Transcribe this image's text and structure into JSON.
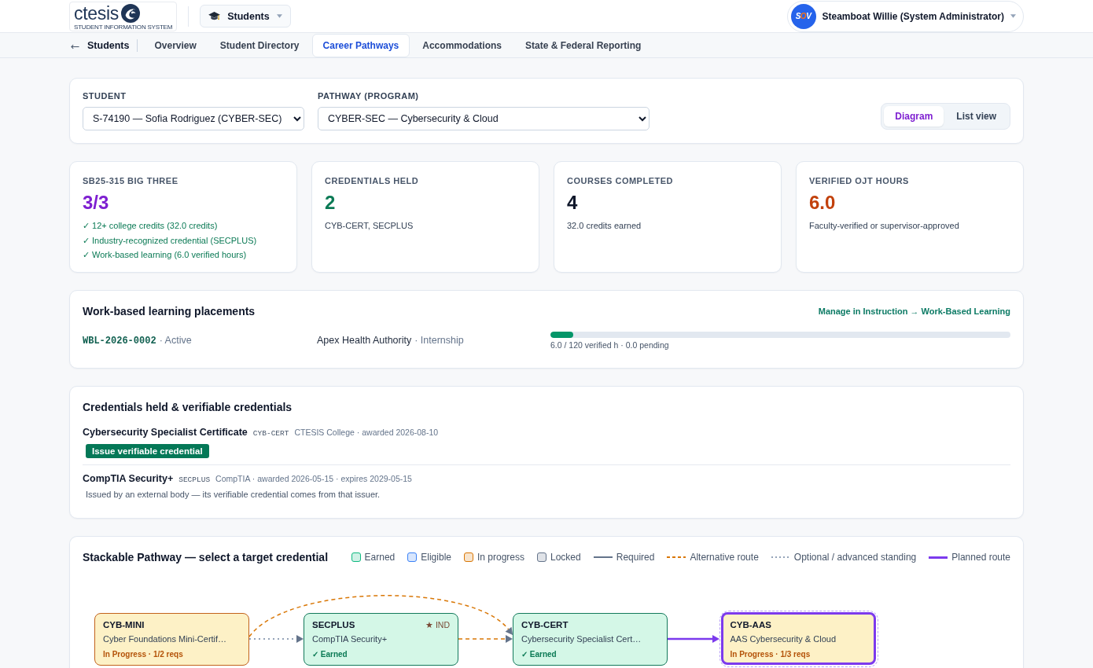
{
  "header": {
    "logo": {
      "wordmark": "ctesis",
      "tagline": "STUDENT INFORMATION SYSTEM"
    },
    "module": {
      "label": "Students"
    },
    "user": {
      "avatar": "SOV",
      "name": "Steamboat Willie (System Administrator)"
    }
  },
  "subnav": {
    "section": "Students",
    "tabs": [
      {
        "label": "Overview",
        "selected": false
      },
      {
        "label": "Student Directory",
        "selected": false
      },
      {
        "label": "Career Pathways",
        "selected": true
      },
      {
        "label": "Accommodations",
        "selected": false
      },
      {
        "label": "State & Federal Reporting",
        "selected": false
      }
    ]
  },
  "filters": {
    "fields": [
      {
        "label": "STUDENT",
        "value": "S-74190 — Sofia Rodriguez (CYBER-SEC)"
      },
      {
        "label": "PATHWAY (PROGRAM)",
        "value": "CYBER-SEC — Cybersecurity & Cloud"
      }
    ],
    "views": [
      {
        "label": "Diagram",
        "selected": true
      },
      {
        "label": "List view",
        "selected": false
      }
    ]
  },
  "stats": [
    {
      "label": "SB25-315 BIG THREE",
      "value": "3/3",
      "color": "#7e1fd1",
      "checks": [
        "✓ 12+ college credits (32.0 credits)",
        "✓ Industry-recognized credential (SECPLUS)",
        "✓ Work-based learning (6.0 verified hours)"
      ]
    },
    {
      "label": "CREDENTIALS HELD",
      "value": "2",
      "color": "#0b7a55",
      "note": "CYB-CERT, SECPLUS"
    },
    {
      "label": "COURSES COMPLETED",
      "value": "4",
      "color": "#0f172a",
      "note": "32.0 credits earned"
    },
    {
      "label": "VERIFIED OJT HOURS",
      "value": "6.0",
      "color": "#c2410c",
      "note": "Faculty-verified or supervisor-approved"
    }
  ],
  "wbl": {
    "title": "Work-based learning placements",
    "link": "Manage in Instruction → Work-Based Learning",
    "placements": [
      {
        "id": "WBL-2026-0002",
        "status": "· Active",
        "employer": "Apex Health Authority",
        "type": "· Internship",
        "level": 0.05,
        "hours": "6.0 / 120 verified h · 0.0 pending"
      }
    ]
  },
  "credentials": {
    "title": "Credentials held & verifiable credentials",
    "items": [
      {
        "name": "Cybersecurity Specialist Certificate",
        "code": "CYB-CERT",
        "meta": "CTESIS College · awarded 2026-08-10",
        "action": "Issue verifiable credential"
      },
      {
        "name": "CompTIA Security+",
        "code": "SECPLUS",
        "meta": "CompTIA · awarded 2026-05-15 · expires 2029-05-15",
        "note": "Issued by an external body — its verifiable credential comes from that issuer."
      }
    ]
  },
  "pathway": {
    "title": "Stackable Pathway — select a target credential",
    "legend": [
      {
        "kind": "status",
        "color": "#10b981",
        "label": "Earned"
      },
      {
        "kind": "status",
        "color": "#3b82f6",
        "label": "Eligible"
      },
      {
        "kind": "status",
        "color": "#d97706",
        "label": "In progress"
      },
      {
        "kind": "status",
        "color": "#64748b",
        "label": "Locked"
      },
      {
        "kind": "route",
        "color": "#64748b",
        "label": "Required"
      },
      {
        "kind": "route",
        "color": "#d97706",
        "dashed": true,
        "label": "Alternative route"
      },
      {
        "kind": "route",
        "color": "#94a3b8",
        "dotted": true,
        "label": "Optional / advanced standing"
      },
      {
        "kind": "route",
        "color": "#7c3aed",
        "thick": true,
        "label": "Planned route"
      }
    ],
    "nodes": [
      {
        "kind": "in_progress",
        "code": "CYB-MINI",
        "name": "Cyber Foundations Mini-Certif…",
        "status_text": "In Progress · 1/2 reqs",
        "selected": false,
        "to_next": {
          "kind": "optional"
        },
        "to_next_but_one": {
          "kind": "alternative"
        }
      },
      {
        "kind": "earned",
        "code": "SECPLUS",
        "badge": "★ IND",
        "name": "CompTIA Security+",
        "status_text": "✓ Earned",
        "selected": false,
        "to_next": {
          "kind": "alternative"
        }
      },
      {
        "kind": "earned",
        "code": "CYB-CERT",
        "name": "Cybersecurity Specialist Cert…",
        "status_text": "✓ Earned",
        "selected": false,
        "to_next": {
          "kind": "planned"
        }
      },
      {
        "kind": "in_progress",
        "code": "CYB-AAS",
        "name": "AAS Cybersecurity & Cloud",
        "status_text": "In Progress · 1/3 reqs",
        "selected": true
      }
    ]
  }
}
